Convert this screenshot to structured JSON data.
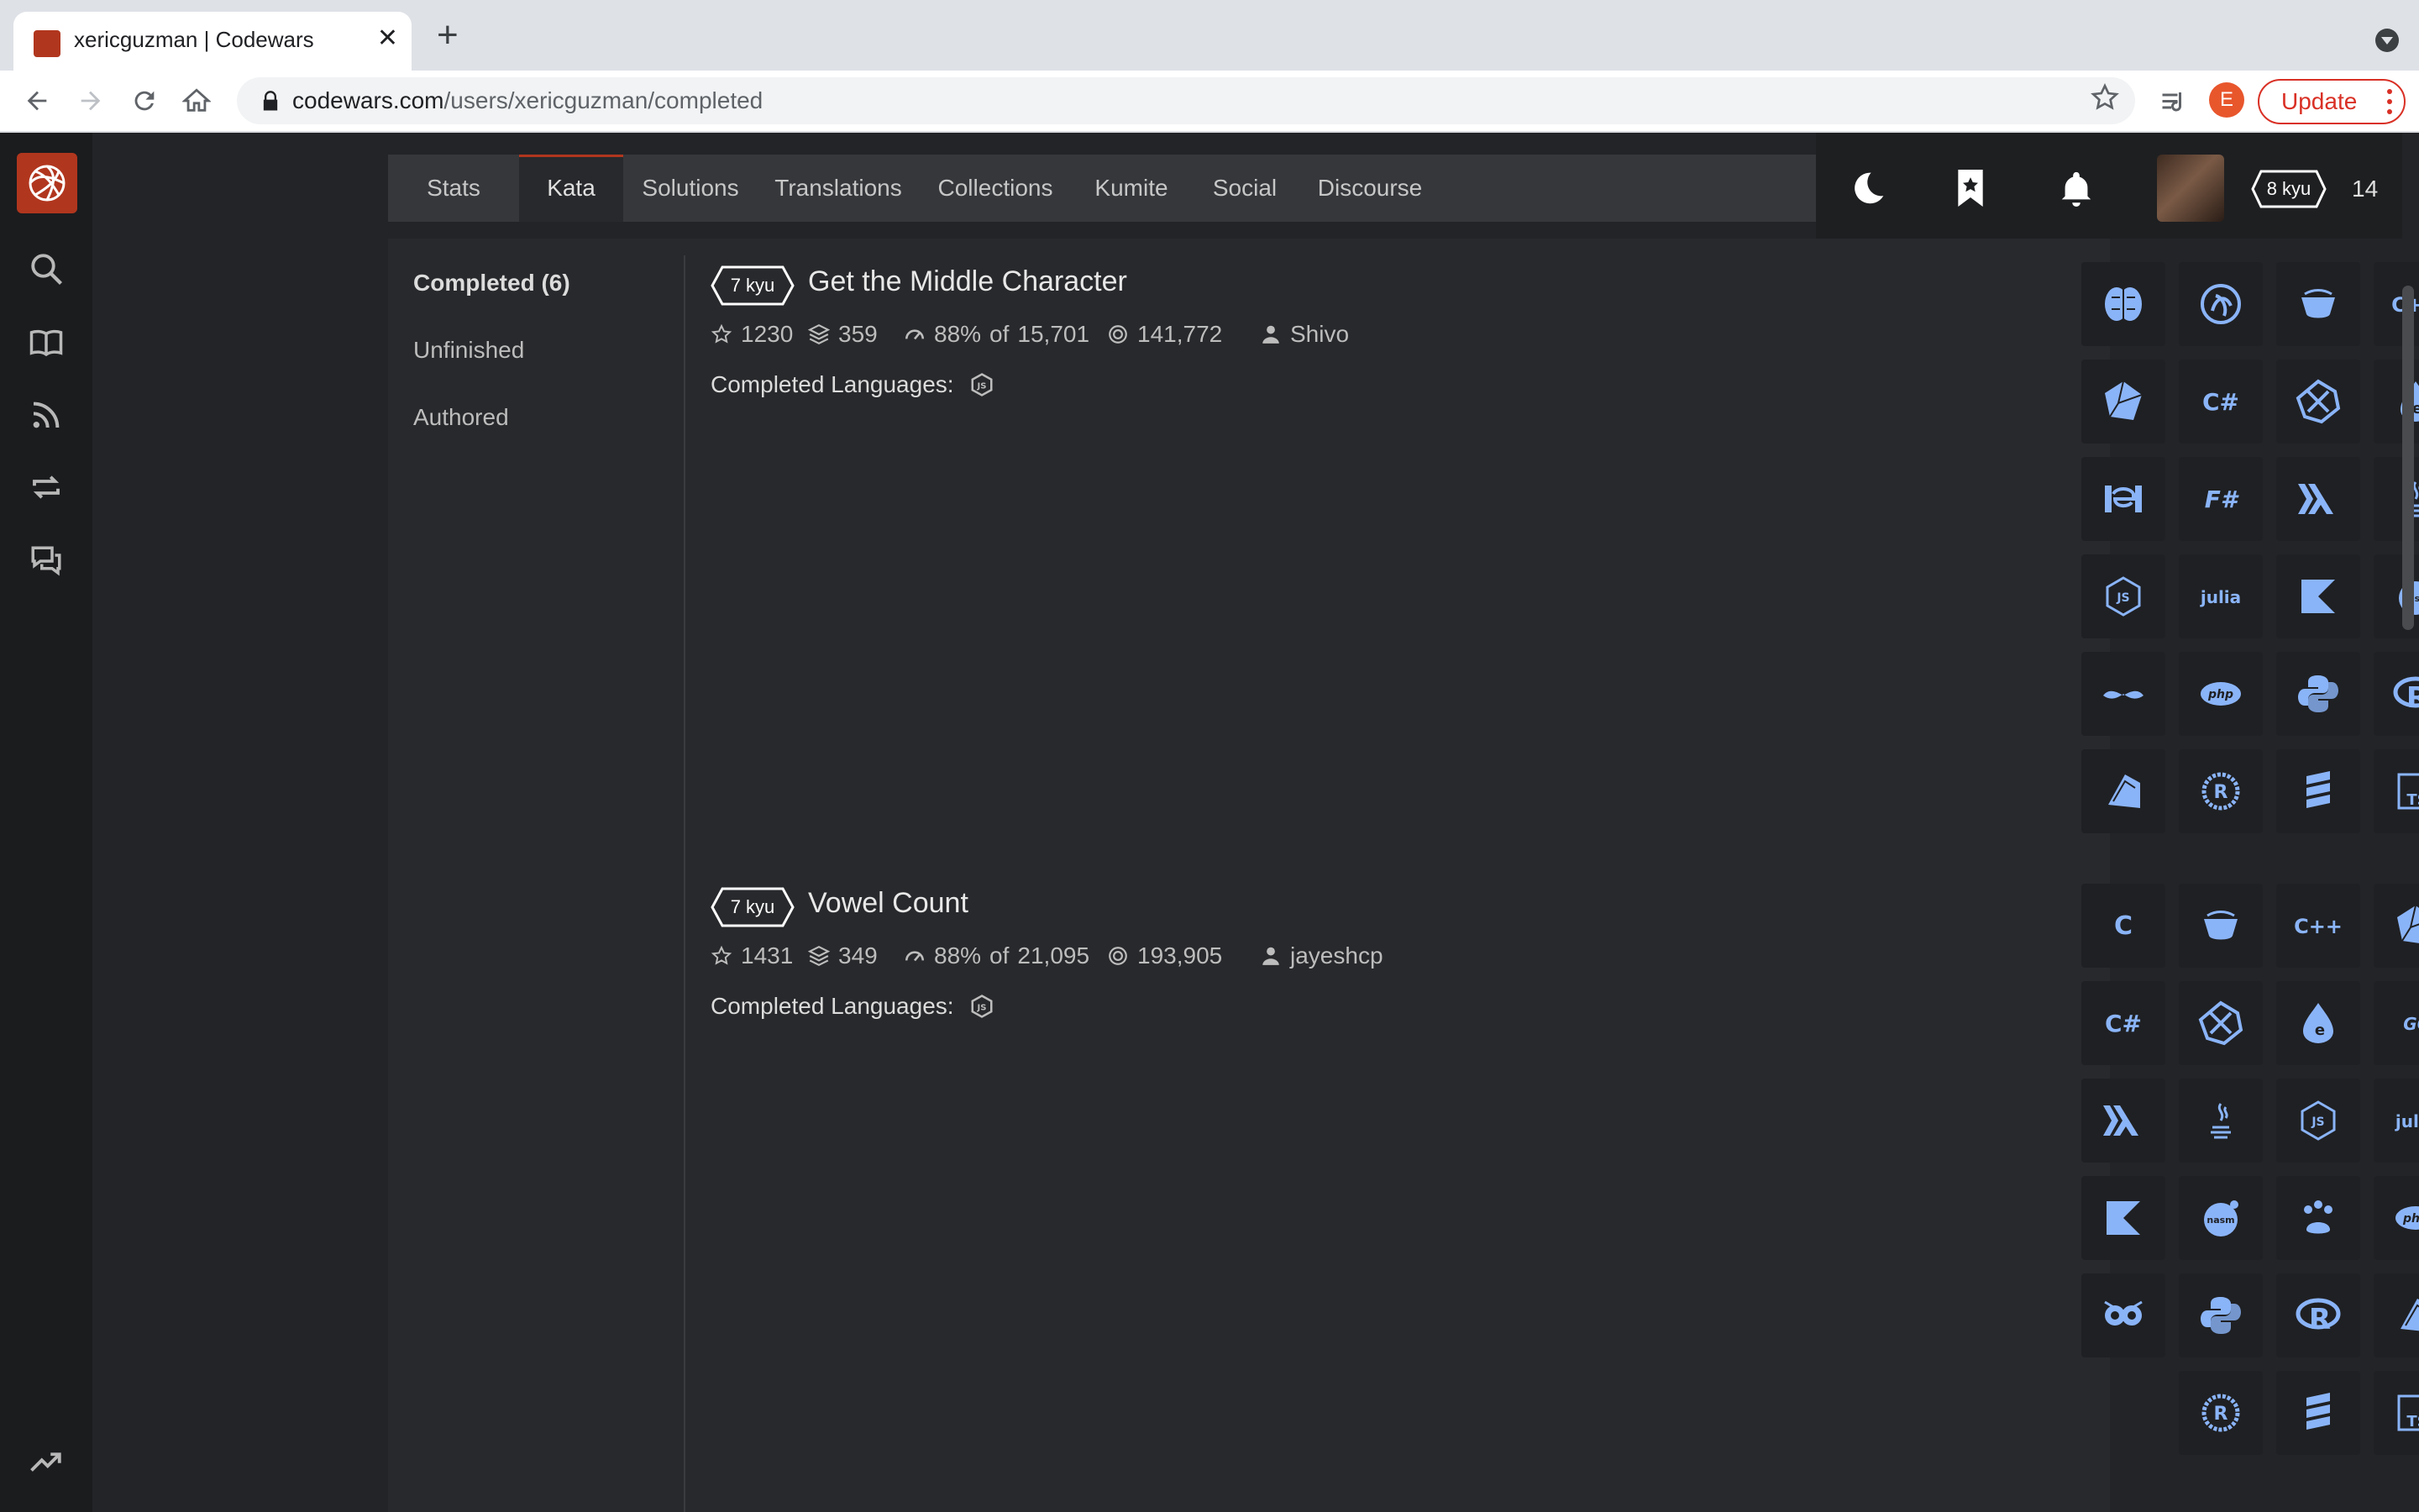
{
  "browser": {
    "tab_title": "xericguzman | Codewars",
    "new_tab": "+",
    "close": "✕",
    "url_host": "codewars.com",
    "url_path": "/users/xericguzman/completed",
    "profile_initial": "E",
    "update_label": "Update"
  },
  "colors": {
    "brand": "#b1361e",
    "lang_icon": "#8ab4f8",
    "panel": "#28292c"
  },
  "sidebar": {
    "icons": [
      "search-icon",
      "book-icon",
      "rss-icon",
      "repeat-icon",
      "chat-icon",
      "trending-icon"
    ]
  },
  "nav": {
    "tabs": [
      {
        "label": "Stats"
      },
      {
        "label": "Kata"
      },
      {
        "label": "Solutions"
      },
      {
        "label": "Translations"
      },
      {
        "label": "Collections"
      },
      {
        "label": "Kumite"
      },
      {
        "label": "Social"
      },
      {
        "label": "Discourse"
      }
    ],
    "active_tab": "Kata"
  },
  "user": {
    "rank": "8 kyu",
    "honor": "14"
  },
  "subnav": {
    "items": [
      {
        "label": "Completed (6)"
      },
      {
        "label": "Unfinished"
      },
      {
        "label": "Authored"
      }
    ]
  },
  "katas": [
    {
      "rank": "7 kyu",
      "title": "Get the Middle Character",
      "stars": "1230",
      "collections": "359",
      "satisfaction": "88%",
      "of": "of",
      "votes": "15,701",
      "completions": "141,772",
      "author": "Shivo",
      "completed_label": "Completed Languages:",
      "languages": [
        "brainfuck",
        "clojure",
        "coffeescript",
        "c++",
        "crystal",
        "c#",
        "dart",
        "elixir",
        "erlang",
        "f#",
        "haskell",
        "java",
        "javascript",
        "julia",
        "kotlin",
        "nasm",
        "perl",
        "php",
        "python",
        "r",
        "ruby",
        "rust",
        "scala",
        "typescript"
      ]
    },
    {
      "rank": "7 kyu",
      "title": "Vowel Count",
      "stars": "1431",
      "collections": "349",
      "satisfaction": "88%",
      "of": "of",
      "votes": "21,095",
      "completions": "193,905",
      "author": "jayeshcp",
      "completed_label": "Completed Languages:",
      "languages": [
        "c",
        "coffeescript",
        "c++",
        "crystal",
        "c#",
        "dart",
        "elixir",
        "go",
        "haskell",
        "java",
        "javascript",
        "julia",
        "kotlin",
        "nasm",
        "pawn",
        "php",
        "powershell",
        "python",
        "r",
        "ruby",
        "rust",
        "scala",
        "typescript"
      ]
    }
  ]
}
